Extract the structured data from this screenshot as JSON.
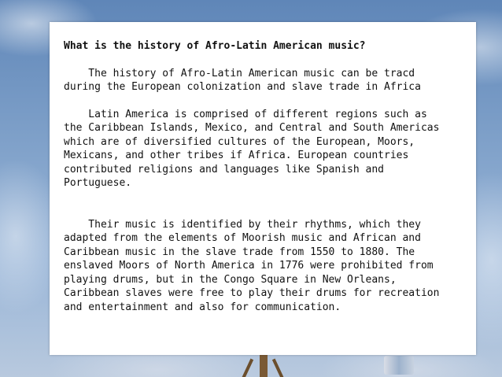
{
  "slide": {
    "title": "What is the history of Afro-Latin American music?",
    "paragraphs": [
      "    The history of Afro-Latin American music can be tracd\nduring the European colonization and slave trade in Africa",
      "    Latin America is comprised of different regions such as\nthe Caribbean Islands, Mexico, and Central and South Americas\nwhich are of diversified cultures of the European, Moors,\nMexicans, and other tribes if Africa. European countries\ncontributed religions and languages like Spanish and\nPortuguese.",
      "    Their music is identified by their rhythms, which they\nadapted from the elements of Moorish music and African and\nCaribbean music in the slave trade from 1550 to 1880. The\nenslaved Moors of North America in 1776 were prohibited from\nplaying drums, but in the Congo Square in New Orleans,\nCaribbean slaves were free to play their drums for recreation\nand entertainment and also for communication."
    ]
  },
  "background": {
    "sky_color": "#7d9fc8"
  }
}
